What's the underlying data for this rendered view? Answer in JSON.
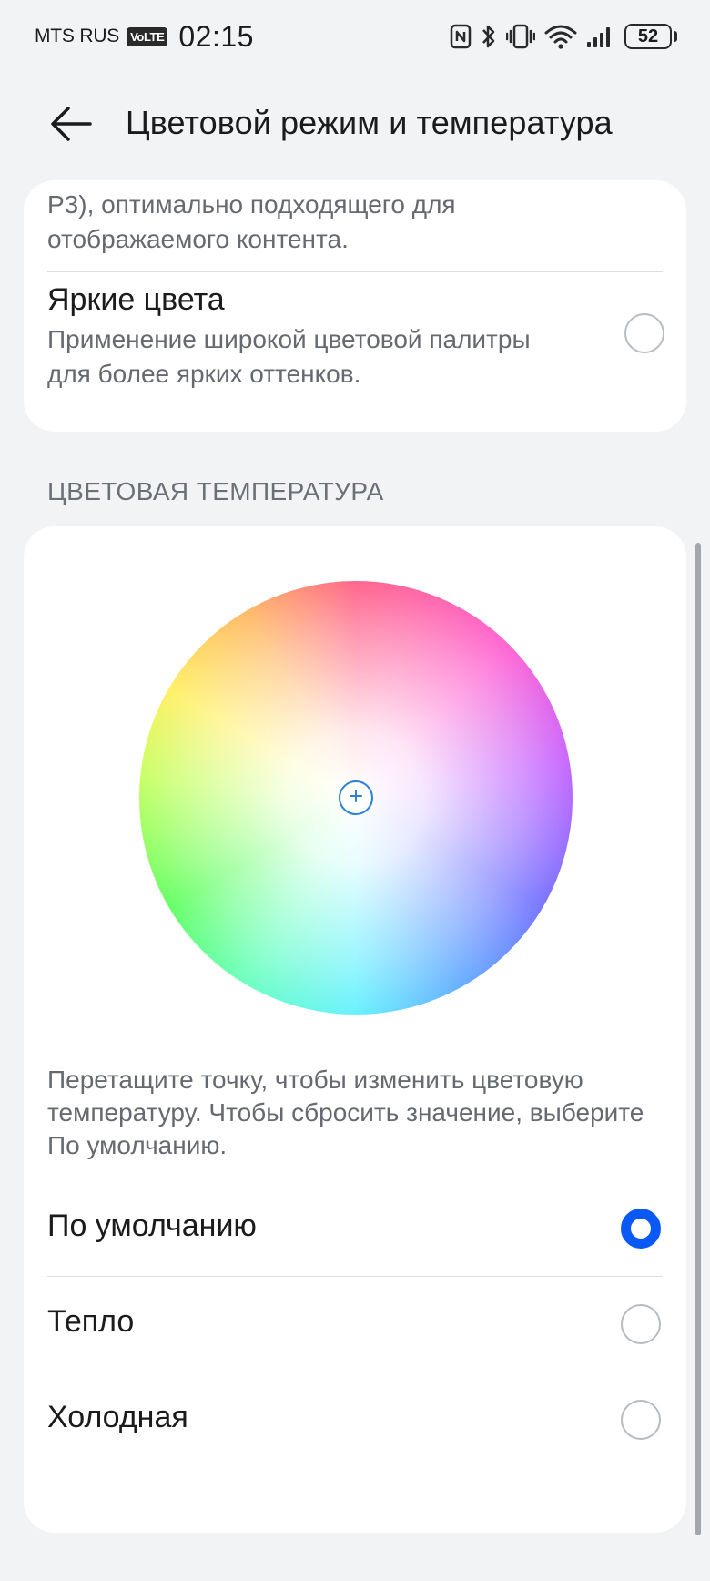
{
  "status_bar": {
    "carrier": "MTS RUS",
    "volte": "VoLTE",
    "time": "02:15",
    "battery": "52",
    "icons": [
      "nfc-icon",
      "bluetooth-icon",
      "vibrate-icon",
      "wifi-icon",
      "cellular-signal-icon",
      "battery-icon"
    ]
  },
  "header": {
    "back_icon": "back-arrow-icon",
    "title": "Цветовой режим и температура"
  },
  "color_mode_card": {
    "desc_tail": "P3), оптимально подходящего для отображаемого контента.",
    "vivid": {
      "title": "Яркие цвета",
      "description": "Применение широкой цветовой палитры для более ярких оттенков.",
      "selected": false
    }
  },
  "temperature": {
    "section_title": "ЦВЕТОВАЯ ТЕМПЕРАТУРА",
    "hint": "Перетащите точку, чтобы изменить цветовую температуру. Чтобы сбросить значение, выберите По умолчанию.",
    "options": [
      {
        "label": "По умолчанию",
        "selected": true
      },
      {
        "label": "Тепло",
        "selected": false
      },
      {
        "label": "Холодная",
        "selected": false
      }
    ]
  },
  "colors": {
    "accent": "#0a59f7",
    "background": "#f1f3f5",
    "card": "#ffffff"
  }
}
